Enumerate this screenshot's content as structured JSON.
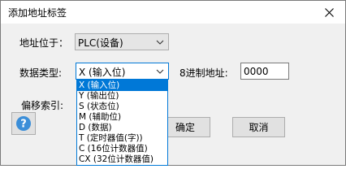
{
  "window": {
    "title": "添加地址标签"
  },
  "form": {
    "address_label": "地址位于：",
    "address_value": "PLC(设备)",
    "datatype_label": "数据类型:",
    "datatype_value": "X (输入位)",
    "octal_label": "8进制地址:",
    "octal_value": "0000",
    "offset_label": "偏移索引:"
  },
  "buttons": {
    "ok": "确定",
    "cancel": "取消",
    "help": "?"
  },
  "dropdown": {
    "items": [
      "X (输入位)",
      "Y (输出位)",
      "S (状态位)",
      "M (辅助位)",
      "D (数据)",
      "T (定时器值(字))",
      "C (16位计数器值)",
      "CX (32位计数器值)"
    ],
    "selected_index": 0
  },
  "colors": {
    "accent": "#0078d7",
    "dialog_bg": "#f0f0f0",
    "help_icon": "#3b8ed8"
  },
  "icons": {
    "close": "close-icon",
    "combo_arrow": "chevron-down-icon",
    "help": "help-icon"
  }
}
